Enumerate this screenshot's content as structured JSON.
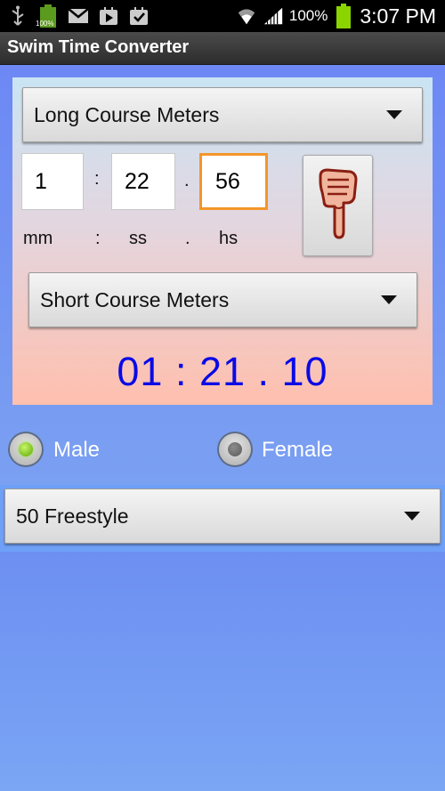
{
  "status_bar": {
    "battery_small_label": "100%",
    "battery_percent": "100%",
    "time": "3:07 PM",
    "icons": [
      "usb-icon",
      "battery-small-icon",
      "gmail-icon",
      "play-store-icon",
      "download-check-icon",
      "wifi-icon",
      "signal-icon",
      "battery-icon"
    ]
  },
  "app": {
    "title": "Swim Time Converter"
  },
  "converter": {
    "from_course": "Long Course Meters",
    "minutes": "1",
    "seconds": "22",
    "hundredths": "56",
    "sep_colon": ":",
    "sep_dot": ".",
    "unit_mm": "mm",
    "unit_colon": ":",
    "unit_ss": "ss",
    "unit_dot": ".",
    "unit_hs": "hs",
    "convert_icon": "pointing-hand-icon",
    "to_course": "Short Course Meters",
    "result": "01 : 21 . 10"
  },
  "gender": {
    "male_label": "Male",
    "female_label": "Female",
    "selected": "Male"
  },
  "event": {
    "selected": "50 Freestyle"
  },
  "colors": {
    "accent_result": "#0a0ae6",
    "focus_orange": "#f3962a",
    "background_blue": "#6f98f0"
  }
}
